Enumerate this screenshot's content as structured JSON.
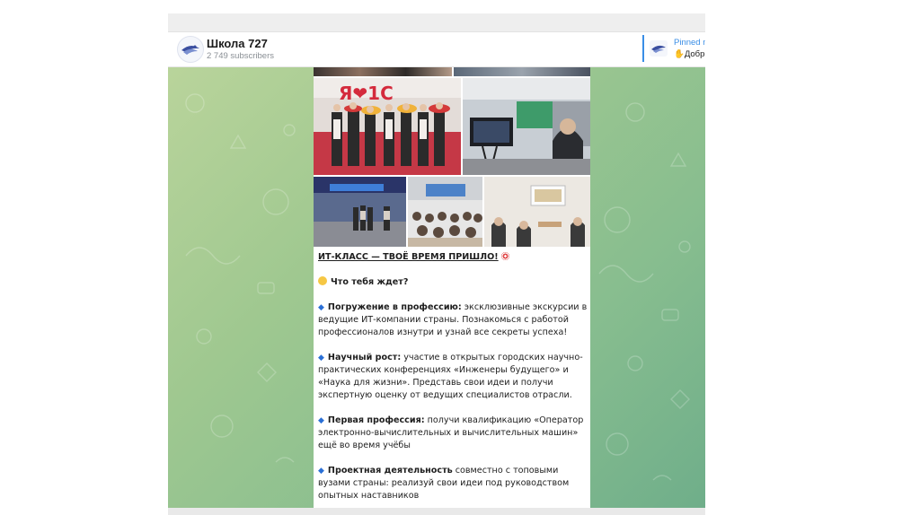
{
  "channel": {
    "name": "Школа 727",
    "subscribers": "2 749 subscribers"
  },
  "pinned": {
    "title": "Pinned m",
    "text": "Добрь"
  },
  "post": {
    "title": "ИТ-КЛАСС — ТВОЁ ВРЕМЯ ПРИШЛО!",
    "question": "Что тебя ждет?",
    "items": [
      {
        "label": "Погружение в профессию:",
        "text": " эксклюзивные экскурсии в ведущие ИТ-компании страны. Познакомься с работой профессионалов изнутри и узнай все секреты успеха!"
      },
      {
        "label": "Научный рост:",
        "text": " участие в открытых городских научно-практических конференциях «Инженеры будущего» и «Наука для жизни». Представь свои идеи и получи экспертную оценку от ведущих специалистов отрасли."
      },
      {
        "label": "Первая профессия:",
        "text": " получи квалификацию «Оператор электронно-вычислительных и вычислительных машин» ещё во время учёбы"
      },
      {
        "label": "Проектная деятельность",
        "text": " совместно с топовыми вузами страны: реализуй свои идеи под руководством опытных наставников"
      }
    ],
    "photo_sign": "Я❤1С"
  },
  "colors": {
    "accent": "#3a8ee6",
    "chat_bg_start": "#b9d49b",
    "chat_bg_end": "#6fae8a",
    "diamond": "#2a6fd6"
  },
  "icons": {
    "avatar": "school-logo-icon",
    "bullet": "blue-diamond-icon",
    "question": "thinking-face-icon",
    "title": "target-icon",
    "pinned_text": "waving-hand-icon"
  }
}
